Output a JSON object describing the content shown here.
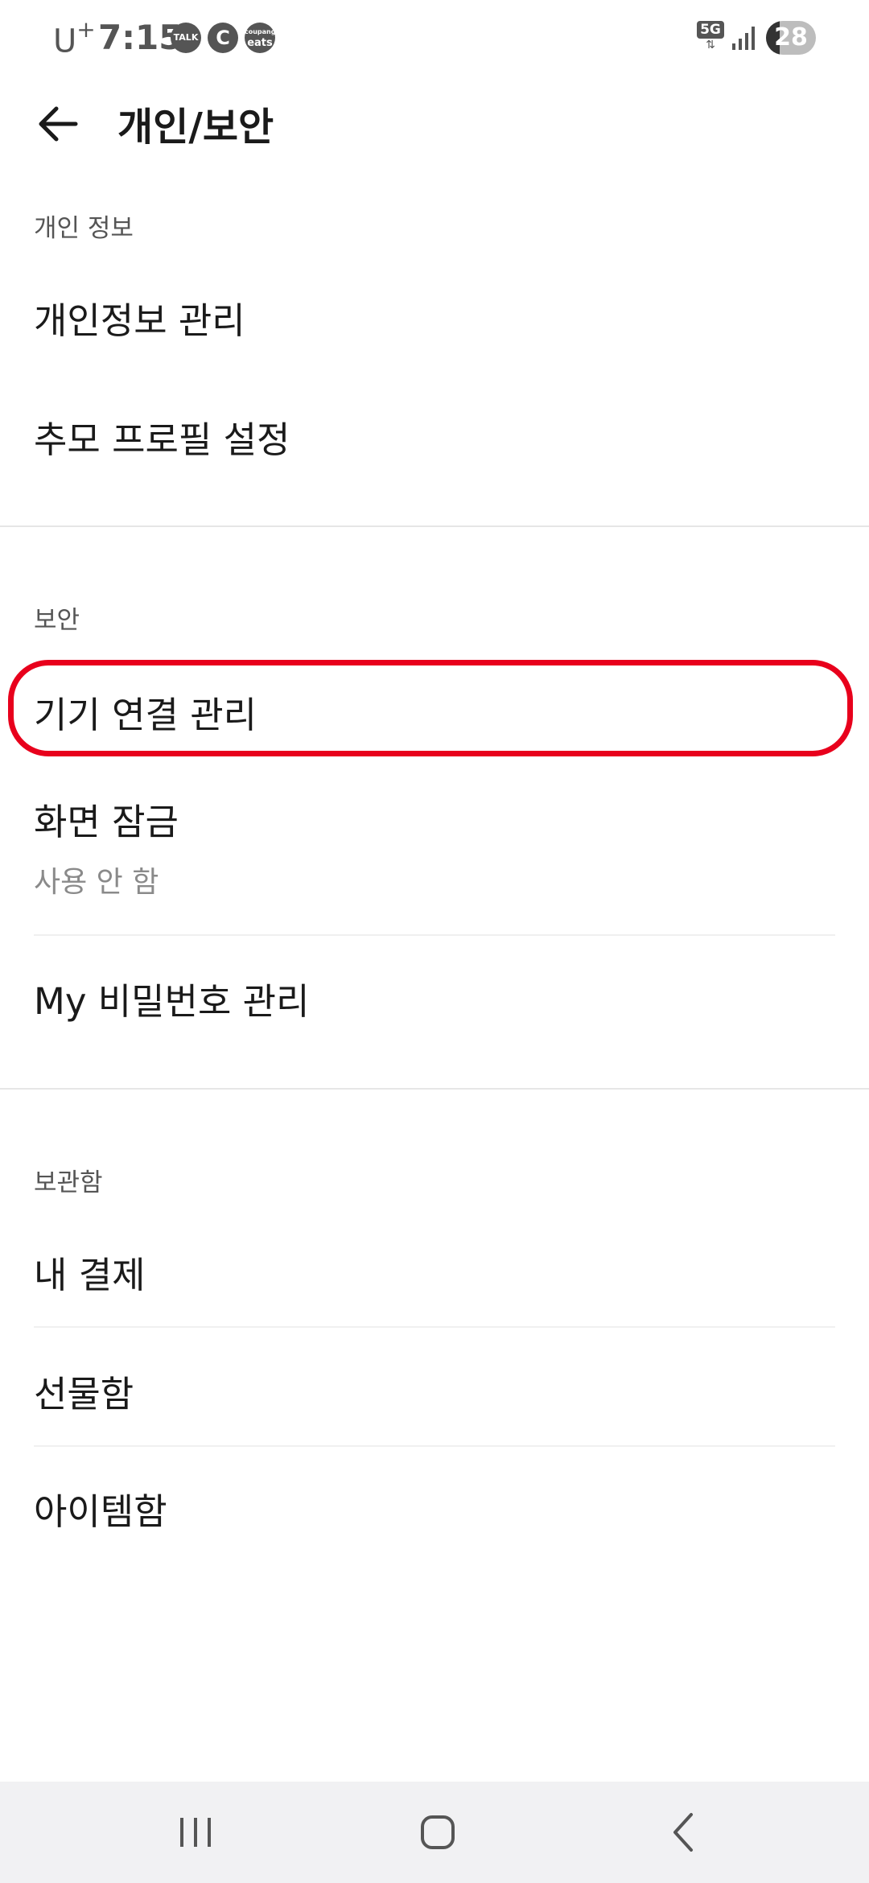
{
  "status_bar": {
    "carrier": "U",
    "carrier_sup": "+",
    "time": "7:15",
    "notifications": {
      "talk": "TALK",
      "c": "C",
      "eats_top": "coupang",
      "eats_bottom": "eats"
    },
    "network": "5G",
    "battery_level": "28"
  },
  "header": {
    "back_icon": "arrow-left-icon",
    "title": "개인/보안"
  },
  "sections": {
    "personal": {
      "label": "개인 정보",
      "items": [
        {
          "label": "개인정보 관리"
        },
        {
          "label": "추모 프로필 설정"
        }
      ]
    },
    "security": {
      "label": "보안",
      "items": [
        {
          "label": "기기 연결 관리"
        },
        {
          "label": "화면 잠금",
          "sub": "사용 안 함"
        },
        {
          "label": "My 비밀번호 관리"
        }
      ]
    },
    "storage": {
      "label": "보관함",
      "items": [
        {
          "label": "내 결제"
        },
        {
          "label": "선물함"
        },
        {
          "label": "아이템함"
        }
      ]
    }
  },
  "highlight_color": "#e8001c",
  "nav_bar": {
    "recents_icon": "recents-icon",
    "home_icon": "home-icon",
    "back_icon": "back-chevron-icon"
  }
}
